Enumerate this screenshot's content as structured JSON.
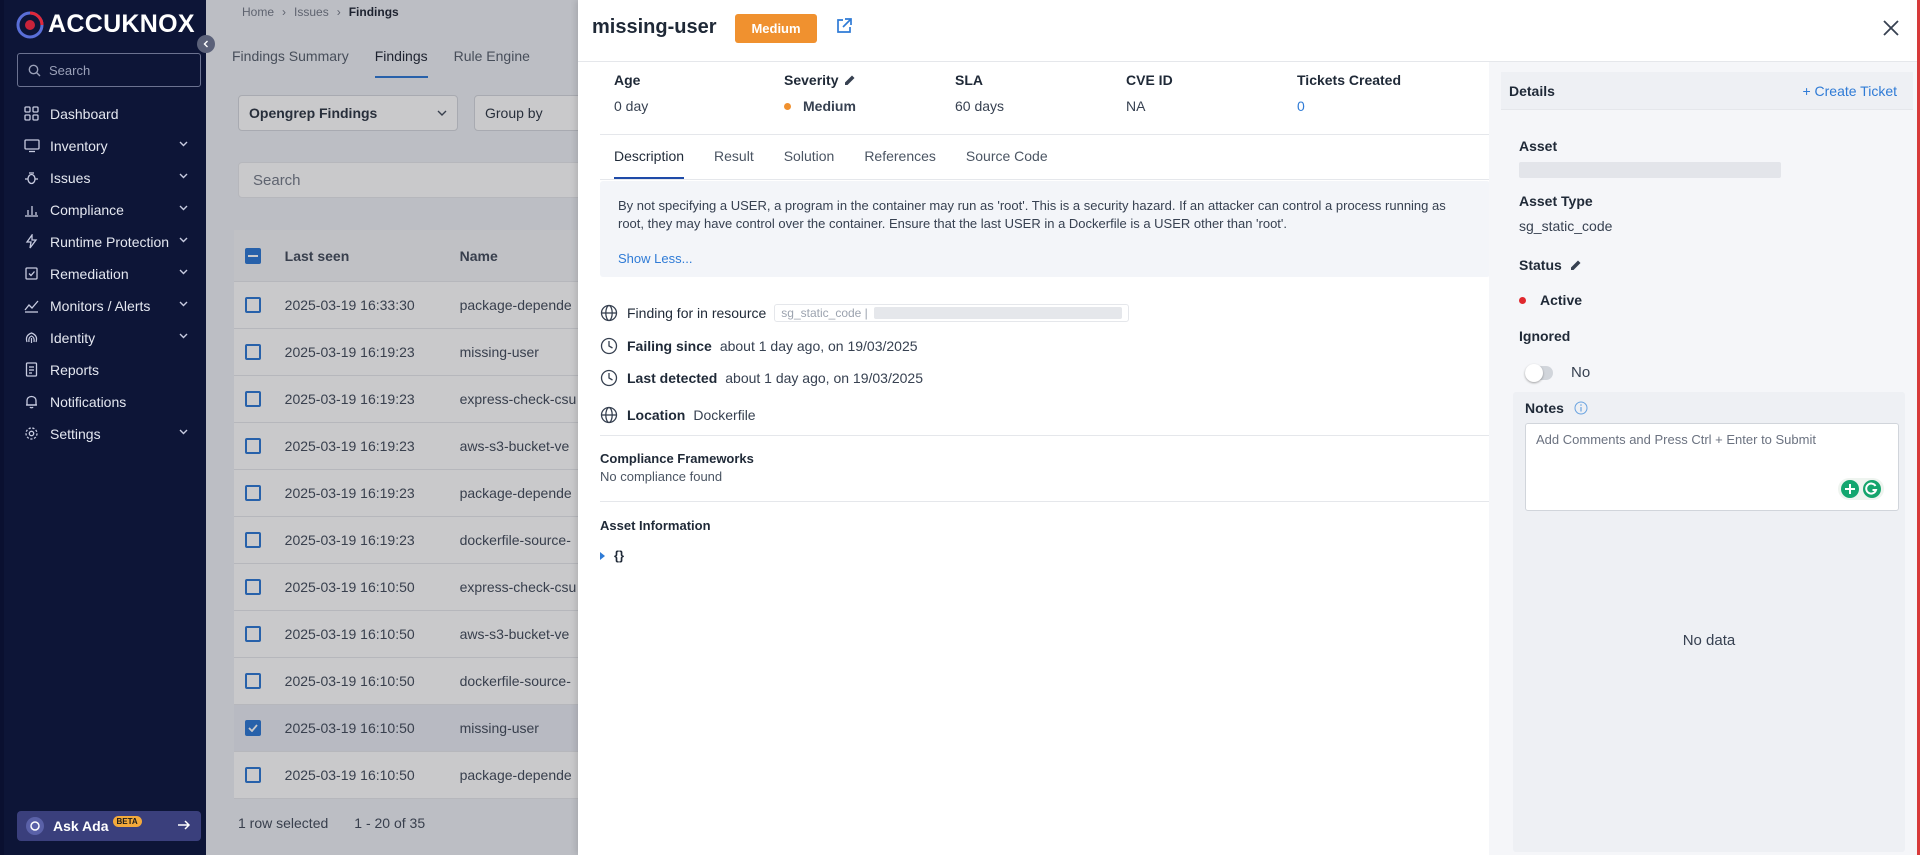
{
  "brand": {
    "name": "ACCUKNOX"
  },
  "sidebar": {
    "search_placeholder": "Search",
    "items": [
      {
        "label": "Dashboard",
        "icon": "dashboard-icon",
        "expandable": false
      },
      {
        "label": "Inventory",
        "icon": "inventory-icon",
        "expandable": true
      },
      {
        "label": "Issues",
        "icon": "bug-icon",
        "expandable": true
      },
      {
        "label": "Compliance",
        "icon": "bar-chart-icon",
        "expandable": true
      },
      {
        "label": "Runtime Protection",
        "icon": "runtime-icon",
        "expandable": true
      },
      {
        "label": "Remediation",
        "icon": "remediation-icon",
        "expandable": true
      },
      {
        "label": "Monitors / Alerts",
        "icon": "monitor-icon",
        "expandable": true
      },
      {
        "label": "Identity",
        "icon": "fingerprint-icon",
        "expandable": true
      },
      {
        "label": "Reports",
        "icon": "reports-icon",
        "expandable": false
      },
      {
        "label": "Notifications",
        "icon": "bell-icon",
        "expandable": false
      },
      {
        "label": "Settings",
        "icon": "gear-icon",
        "expandable": true
      }
    ],
    "ask_ada": {
      "label": "Ask Ada",
      "badge": "BETA"
    }
  },
  "main": {
    "breadcrumb": [
      "Home",
      "Issues",
      "Findings"
    ],
    "tabs": [
      "Findings Summary",
      "Findings",
      "Rule Engine"
    ],
    "active_tab": "Findings",
    "filter_source": "Opengrep Findings",
    "group_by": "Group by",
    "search_placeholder": "Search",
    "table": {
      "headers": [
        "Last seen",
        "Name"
      ],
      "rows": [
        {
          "seen": "2025-03-19 16:33:30",
          "name": "package-depende",
          "checked": false
        },
        {
          "seen": "2025-03-19 16:19:23",
          "name": "missing-user",
          "checked": false
        },
        {
          "seen": "2025-03-19 16:19:23",
          "name": "express-check-csu",
          "checked": false
        },
        {
          "seen": "2025-03-19 16:19:23",
          "name": "aws-s3-bucket-ve",
          "checked": false
        },
        {
          "seen": "2025-03-19 16:19:23",
          "name": "package-depende",
          "checked": false
        },
        {
          "seen": "2025-03-19 16:19:23",
          "name": "dockerfile-source-",
          "checked": false
        },
        {
          "seen": "2025-03-19 16:10:50",
          "name": "express-check-csu",
          "checked": false
        },
        {
          "seen": "2025-03-19 16:10:50",
          "name": "aws-s3-bucket-ve",
          "checked": false
        },
        {
          "seen": "2025-03-19 16:10:50",
          "name": "dockerfile-source-",
          "checked": false
        },
        {
          "seen": "2025-03-19 16:10:50",
          "name": "missing-user",
          "checked": true
        },
        {
          "seen": "2025-03-19 16:10:50",
          "name": "package-depende",
          "checked": false
        }
      ]
    },
    "footer": {
      "selected": "1 row selected",
      "range": "1 - 20 of 35"
    }
  },
  "drawer": {
    "title": "missing-user",
    "severity_badge": "Medium",
    "meta": {
      "age": {
        "label": "Age",
        "value": "0 day"
      },
      "severity": {
        "label": "Severity",
        "value": "Medium"
      },
      "sla": {
        "label": "SLA",
        "value": "60 days"
      },
      "cve": {
        "label": "CVE ID",
        "value": "NA"
      },
      "tickets": {
        "label": "Tickets Created",
        "value": "0"
      }
    },
    "tabs": [
      "Description",
      "Result",
      "Solution",
      "References",
      "Source Code"
    ],
    "active_tab": "Description",
    "description": "By not specifying a USER, a program in the container may run as 'root'. This is a security hazard. If an attacker can control a process running as root, they may have control over the container. Ensure that the last USER in a Dockerfile is a USER other than 'root'.",
    "show_less": "Show Less...",
    "finding_resource": {
      "label": "Finding for in resource",
      "chip": "sg_static_code |"
    },
    "failing_since": {
      "label": "Failing since",
      "value": "about 1 day ago, on 19/03/2025"
    },
    "last_detected": {
      "label": "Last detected",
      "value": "about 1 day ago, on 19/03/2025"
    },
    "location": {
      "label": "Location",
      "value": "Dockerfile"
    },
    "compliance": {
      "title": "Compliance Frameworks",
      "value": "No compliance found"
    },
    "asset_info": {
      "title": "Asset Information",
      "json": "{}"
    },
    "details": {
      "title": "Details",
      "create_ticket": "+ Create Ticket",
      "asset_label": "Asset",
      "asset_type_label": "Asset Type",
      "asset_type_value": "sg_static_code",
      "status_label": "Status",
      "status_value": "Active",
      "ignored_label": "Ignored",
      "ignored_value": "No",
      "notes_label": "Notes",
      "notes_placeholder": "Add Comments and Press Ctrl + Enter to Submit",
      "no_data": "No data"
    }
  },
  "colors": {
    "sidebar_bg": "#0d1537",
    "severity_medium": "#f0912f",
    "status_active": "#e0282e",
    "link": "#2f7bd6",
    "checkbox": "#1f6fd1"
  }
}
